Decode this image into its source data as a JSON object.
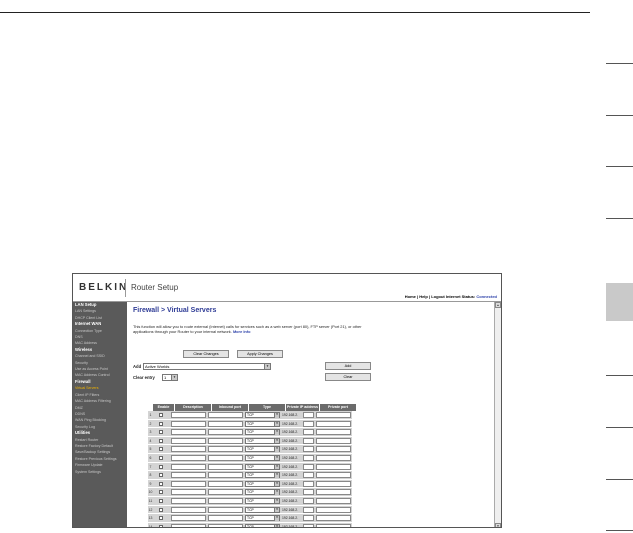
{
  "header": {
    "brand": "BELKIN",
    "product": "Router Setup",
    "links": "Home | Help | Logout   Internet Status:",
    "status": "Connected"
  },
  "sidebar": {
    "items": [
      {
        "label": "LAN Setup",
        "type": "head"
      },
      {
        "label": "LAN Settings",
        "type": "item"
      },
      {
        "label": "DHCP Client List",
        "type": "item"
      },
      {
        "label": "Internet WAN",
        "type": "head"
      },
      {
        "label": "Connection Type",
        "type": "item"
      },
      {
        "label": "DNS",
        "type": "item"
      },
      {
        "label": "MAC Address",
        "type": "item"
      },
      {
        "label": "Wireless",
        "type": "head"
      },
      {
        "label": "Channel and SSID",
        "type": "item"
      },
      {
        "label": "Security",
        "type": "item"
      },
      {
        "label": "Use as Access Point",
        "type": "item"
      },
      {
        "label": "MAC Address Control",
        "type": "item"
      },
      {
        "label": "Firewall",
        "type": "head"
      },
      {
        "label": "Virtual Servers",
        "type": "active"
      },
      {
        "label": "Client IP Filters",
        "type": "item"
      },
      {
        "label": "MAC Address Filtering",
        "type": "item"
      },
      {
        "label": "DMZ",
        "type": "item"
      },
      {
        "label": "DDNS",
        "type": "item"
      },
      {
        "label": "WAN Ping Blocking",
        "type": "item"
      },
      {
        "label": "Security Log",
        "type": "item"
      },
      {
        "label": "Utilities",
        "type": "head"
      },
      {
        "label": "Restart Router",
        "type": "item"
      },
      {
        "label": "Restore Factory Default",
        "type": "item"
      },
      {
        "label": "Save/Backup Settings",
        "type": "item"
      },
      {
        "label": "Restore Previous Settings",
        "type": "item"
      },
      {
        "label": "Firmware Update",
        "type": "item"
      },
      {
        "label": "System Settings",
        "type": "item"
      }
    ]
  },
  "main": {
    "title": "Firewall > Virtual Servers",
    "description": "This function will allow you to route external (Internet) calls for services such as a web server (port 80), FTP server (Port 21), or other applications through your Router to your internal network.",
    "more_info": "More Info",
    "clear_changes": "Clear Changes",
    "apply_changes": "Apply Changes",
    "add_label": "Add",
    "add_select": "Active Worlds",
    "add_button": "Add",
    "clear_entry_label": "Clear entry",
    "clear_entry_select": "1",
    "clear_button": "Clear"
  },
  "table": {
    "headers": [
      "Enable",
      "Description",
      "Inbound port",
      "Type",
      "Private IP address",
      "Private port"
    ],
    "type_value": "TCP",
    "ip_prefix": "192.168.2.",
    "rows": [
      "1",
      "2",
      "3",
      "4",
      "5",
      "6",
      "7",
      "8",
      "9",
      "10",
      "11",
      "12",
      "13",
      "14"
    ]
  }
}
